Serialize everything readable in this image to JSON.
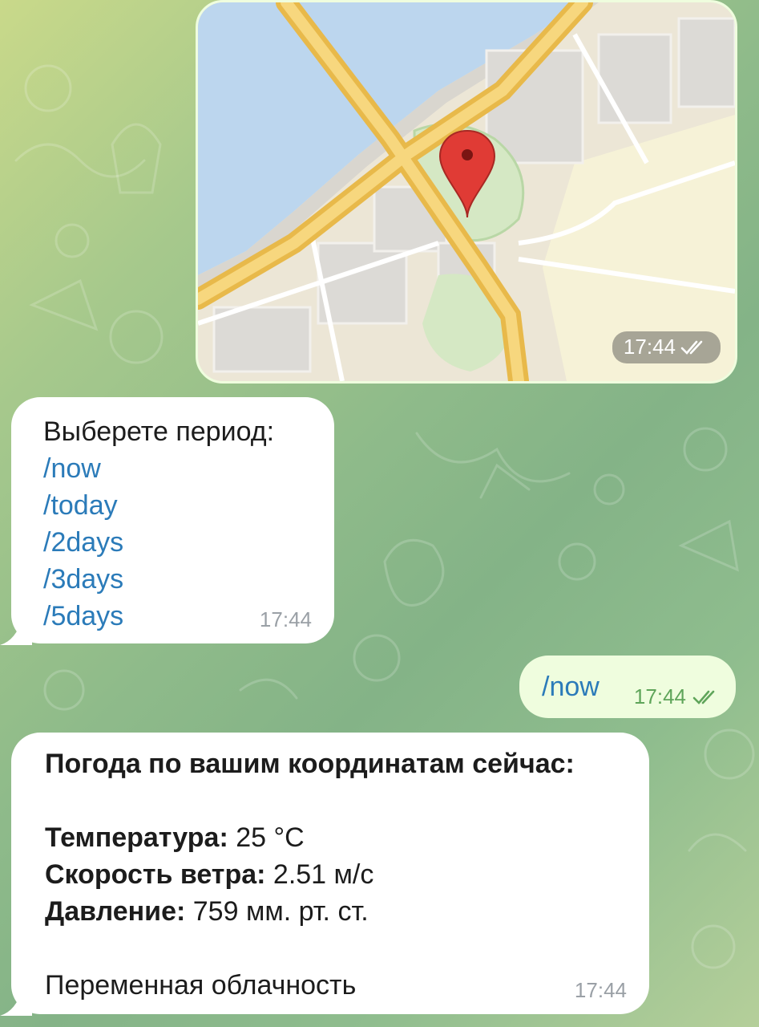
{
  "map_message": {
    "time": "17:44",
    "status": "read-double-check"
  },
  "period_message": {
    "title": "Выберете период:",
    "commands": [
      "/now",
      "/today",
      "/2days",
      "/3days",
      "/5days"
    ],
    "time": "17:44"
  },
  "user_message": {
    "text": "/now",
    "time": "17:44",
    "status": "read-double-check"
  },
  "weather_message": {
    "heading": "Погода по вашим координатам сейчас:",
    "temperature_label": "Температура:",
    "temperature_value": "25 °C",
    "wind_label": "Скорость ветра:",
    "wind_value": "2.51 м/с",
    "pressure_label": "Давление:",
    "pressure_value": "759 мм. рт. ст.",
    "condition": "Переменная облачность",
    "time": "17:44"
  },
  "colors": {
    "incoming_bubble": "#ffffff",
    "outgoing_bubble": "#effdde",
    "link": "#2b7bb9",
    "read_check": "#5fa55a"
  }
}
